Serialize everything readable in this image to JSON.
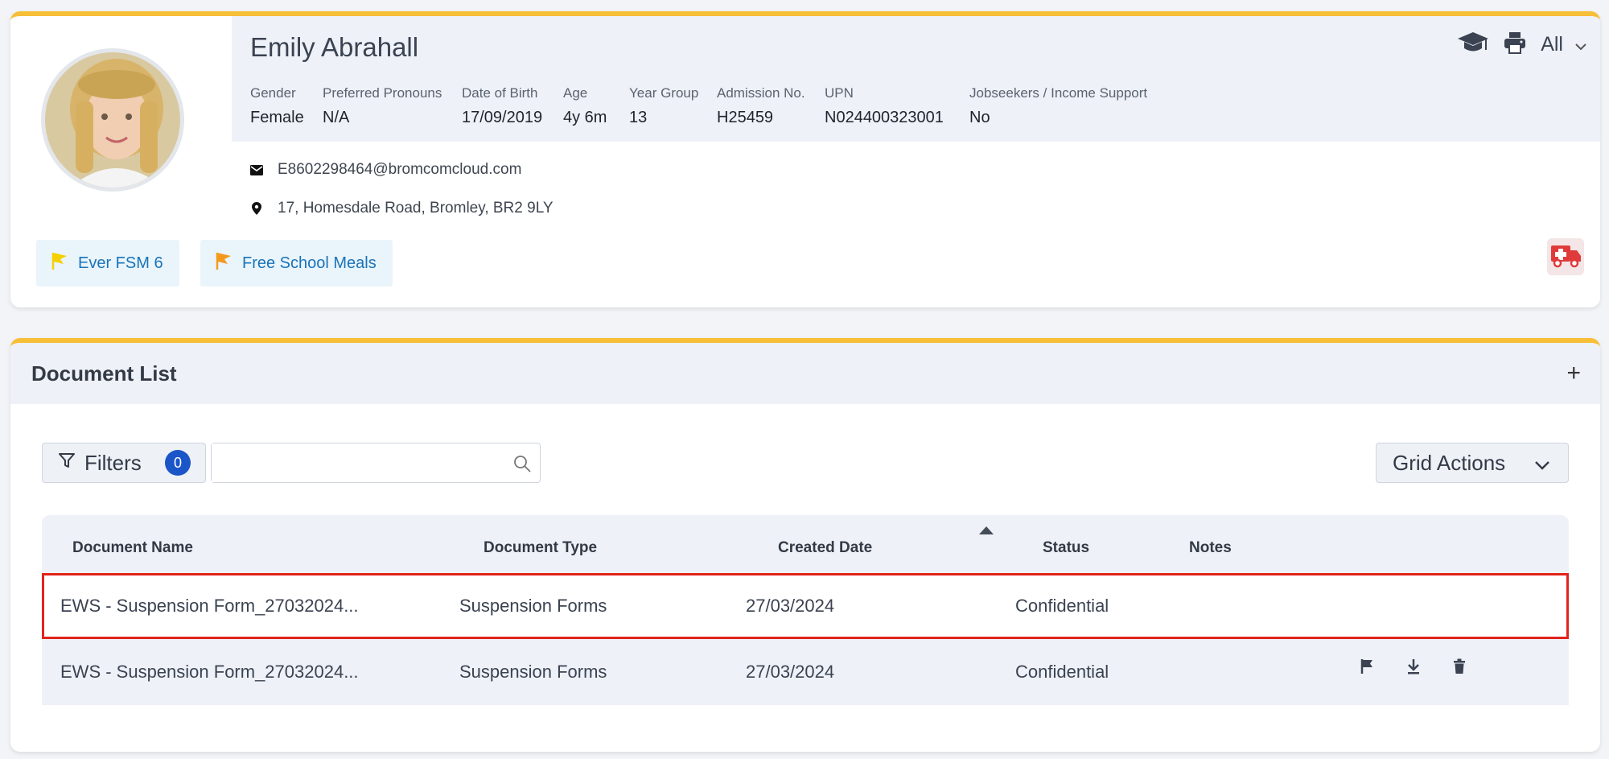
{
  "student": {
    "name": "Emily Abrahall",
    "fields": [
      {
        "label": "Gender",
        "value": "Female"
      },
      {
        "label": "Preferred Pronouns",
        "value": "N/A"
      },
      {
        "label": "Date of Birth",
        "value": "17/09/2019"
      },
      {
        "label": "Age",
        "value": "4y 6m"
      },
      {
        "label": "Year Group",
        "value": "13"
      },
      {
        "label": "Admission No.",
        "value": "H25459"
      },
      {
        "label": "UPN",
        "value": "N024400323001"
      },
      {
        "label": "Jobseekers / Income Support",
        "value": "No"
      }
    ],
    "email": "E8602298464@bromcomcloud.com",
    "address": "17, Homesdale Road, Bromley, BR2 9LY",
    "tags": [
      {
        "label": "Ever FSM 6",
        "flag_color": "#f5d000"
      },
      {
        "label": "Free School Meals",
        "flag_color": "#f39a1e"
      }
    ]
  },
  "top_actions": {
    "icons": [
      "graduation-cap-icon",
      "printer-icon"
    ],
    "scope_label": "All"
  },
  "documents": {
    "title": "Document List",
    "add_label": "+",
    "filters_label": "Filters",
    "filters_count": "0",
    "search_placeholder": "",
    "grid_actions_label": "Grid Actions",
    "columns": [
      "Document Name",
      "Document Type",
      "Created Date",
      "Status",
      "Notes"
    ],
    "rows": [
      {
        "name": "EWS - Suspension Form_27032024...",
        "type": "Suspension Forms",
        "created": "27/03/2024",
        "status": "Confidential",
        "notes": "",
        "selected": true
      },
      {
        "name": "EWS - Suspension Form_27032024...",
        "type": "Suspension Forms",
        "created": "27/03/2024",
        "status": "Confidential",
        "notes": "",
        "selected": false
      }
    ],
    "row_action_icons": [
      "flag-icon",
      "download-icon",
      "trash-icon"
    ]
  },
  "colors": {
    "accent": "#f7be38",
    "badge": "#1a56c8",
    "selection": "#e2231a",
    "medical": "#e03b3b"
  }
}
